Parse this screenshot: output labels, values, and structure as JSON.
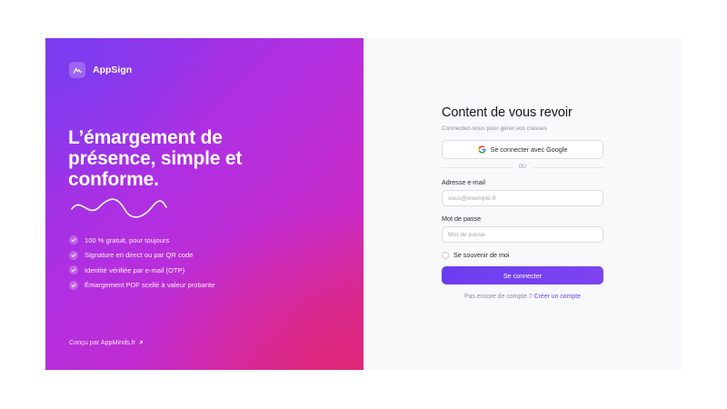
{
  "brand": {
    "name": "AppSign"
  },
  "hero": {
    "headline_lines": [
      "L’émargement de",
      "présence, simple et",
      "conforme."
    ],
    "features": [
      "100 % gratuit, pour toujours",
      "Signature en direct ou par QR code",
      "Identité vérifiée par e-mail (OTP)",
      "Émargement PDF scellé à valeur probante"
    ],
    "credit": "Conçu par AppMinds.fr",
    "credit_icon": "external-link-icon"
  },
  "login": {
    "title": "Content de vous revoir",
    "subtitle": "Connectez-vous pour gérer vos classes",
    "google_button": "Se connecter avec Google",
    "divider_text": "OU",
    "email": {
      "label": "Adresse e-mail",
      "placeholder": "vous@exemple.fr",
      "value": ""
    },
    "password": {
      "label": "Mot de passe",
      "placeholder": "Mot de passe",
      "value": ""
    },
    "remember_label": "Se souvenir de moi",
    "remember_checked": false,
    "submit_button": "Se connecter",
    "signup_prompt": "Pas encore de compte ?",
    "signup_link": "Créer un compte"
  },
  "colors": {
    "accent": "#6c3ef0",
    "gradient_start": "#7a3df0",
    "gradient_end": "#e0287a"
  }
}
